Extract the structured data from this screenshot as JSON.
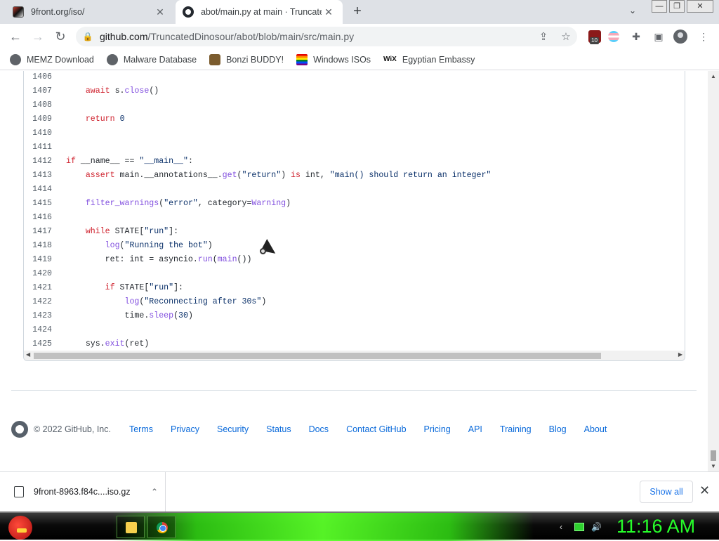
{
  "tabs": [
    {
      "title": "9front.org/iso/",
      "active": false
    },
    {
      "title": "abot/main.py at main · TruncatedDinosour/abot",
      "active": true
    }
  ],
  "toolbar": {
    "url_host": "github.com",
    "url_path": "/TruncatedDinosour/abot/blob/main/src/main.py",
    "extension_badge_count": "10"
  },
  "bookmarks": [
    {
      "label": "MEMZ Download",
      "icon": "globe-icon"
    },
    {
      "label": "Malware Database",
      "icon": "globe-icon"
    },
    {
      "label": "Bonzi BUDDY!",
      "icon": "bonzi-icon"
    },
    {
      "label": "Windows ISOs",
      "icon": "windows-flag-icon"
    },
    {
      "label": "Egyptian Embassy",
      "icon": "wix-icon"
    }
  ],
  "code_lines": [
    {
      "num": "1406",
      "html": ""
    },
    {
      "num": "1407",
      "html": "    <span class=\"kw\">await</span> s.<span class=\"fn\">close</span>()"
    },
    {
      "num": "1408",
      "html": ""
    },
    {
      "num": "1409",
      "html": "    <span class=\"kw\">return</span> <span class=\"str\">0</span>"
    },
    {
      "num": "1410",
      "html": ""
    },
    {
      "num": "1411",
      "html": ""
    },
    {
      "num": "1412",
      "html": "<span class=\"kw\">if</span> __name__ == <span class=\"str\">\"__main__\"</span>:"
    },
    {
      "num": "1413",
      "html": "    <span class=\"kw\">assert</span> main.__annotations__.<span class=\"fn\">get</span>(<span class=\"str\">\"return\"</span>) <span class=\"kw\">is</span> int, <span class=\"str\">\"main() should return an integer\"</span>"
    },
    {
      "num": "1414",
      "html": ""
    },
    {
      "num": "1415",
      "html": "    <span class=\"fn\">filter_warnings</span>(<span class=\"str\">\"error\"</span>, category=<span class=\"fn\">Warning</span>)"
    },
    {
      "num": "1416",
      "html": ""
    },
    {
      "num": "1417",
      "html": "    <span class=\"kw\">while</span> STATE[<span class=\"str\">\"run\"</span>]:"
    },
    {
      "num": "1418",
      "html": "        <span class=\"fn\">log</span>(<span class=\"str\">\"Running the bot\"</span>)"
    },
    {
      "num": "1419",
      "html": "        ret: int = asyncio.<span class=\"fn\">run</span>(<span class=\"fn\">main</span>())"
    },
    {
      "num": "1420",
      "html": ""
    },
    {
      "num": "1421",
      "html": "        <span class=\"kw\">if</span> STATE[<span class=\"str\">\"run\"</span>]:"
    },
    {
      "num": "1422",
      "html": "            <span class=\"fn\">log</span>(<span class=\"str\">\"Reconnecting after 30s\"</span>)"
    },
    {
      "num": "1423",
      "html": "            time.<span class=\"fn\">sleep</span>(<span class=\"str\">30</span>)"
    },
    {
      "num": "1424",
      "html": ""
    },
    {
      "num": "1425",
      "html": "    sys.<span class=\"fn\">exit</span>(ret)"
    }
  ],
  "footer": {
    "copyright": "© 2022 GitHub, Inc.",
    "links": [
      "Terms",
      "Privacy",
      "Security",
      "Status",
      "Docs",
      "Contact GitHub",
      "Pricing",
      "API",
      "Training",
      "Blog",
      "About"
    ]
  },
  "download": {
    "filename": "9front-8963.f84c....iso.gz",
    "show_all": "Show all"
  },
  "taskbar": {
    "clock": "11:16 AM"
  },
  "colors": {
    "link": "#0969da",
    "keyword": "#cf222e",
    "function": "#8250df",
    "string": "#0a3069",
    "clock": "#26ff2a"
  }
}
